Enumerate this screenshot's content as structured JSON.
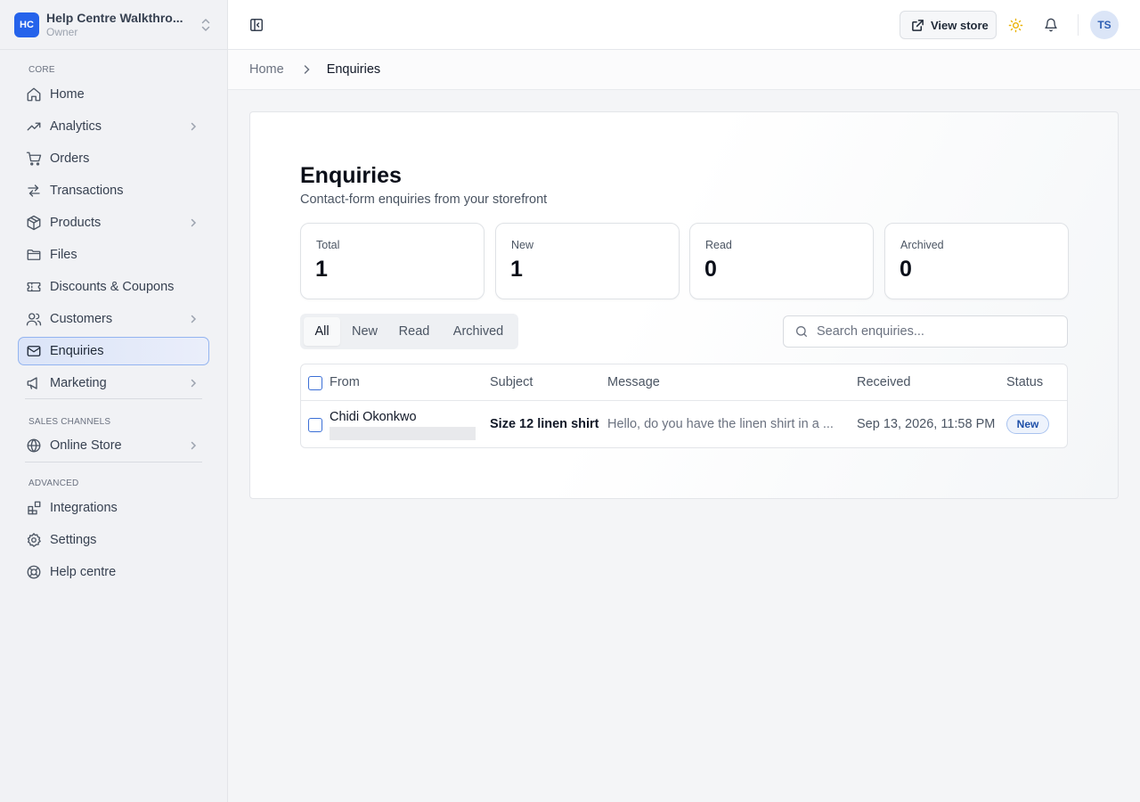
{
  "store": {
    "initials": "HC",
    "name": "Help Centre Walkthro...",
    "role": "Owner"
  },
  "sidebar": {
    "sections": [
      {
        "title": "CORE",
        "items": [
          {
            "label": "Home",
            "icon": "home-icon"
          },
          {
            "label": "Analytics",
            "icon": "trending-up-icon",
            "has_children": true
          },
          {
            "label": "Orders",
            "icon": "cart-icon"
          },
          {
            "label": "Transactions",
            "icon": "arrows-swap-icon"
          },
          {
            "label": "Products",
            "icon": "box-icon",
            "has_children": true
          },
          {
            "label": "Files",
            "icon": "folder-icon"
          },
          {
            "label": "Discounts & Coupons",
            "icon": "ticket-icon"
          },
          {
            "label": "Customers",
            "icon": "users-icon",
            "has_children": true
          },
          {
            "label": "Enquiries",
            "icon": "mail-icon",
            "active": true
          },
          {
            "label": "Marketing",
            "icon": "megaphone-icon",
            "has_children": true
          }
        ]
      },
      {
        "title": "SALES CHANNELS",
        "items": [
          {
            "label": "Online Store",
            "icon": "globe-icon",
            "has_children": true
          }
        ]
      },
      {
        "title": "ADVANCED",
        "items": [
          {
            "label": "Integrations",
            "icon": "blocks-icon"
          },
          {
            "label": "Settings",
            "icon": "gear-icon"
          },
          {
            "label": "Help centre",
            "icon": "lifebuoy-icon"
          }
        ]
      }
    ]
  },
  "topbar": {
    "view_store_label": "View store",
    "avatar_initials": "TS"
  },
  "breadcrumb": {
    "home": "Home",
    "current": "Enquiries"
  },
  "page": {
    "title": "Enquiries",
    "subtitle": "Contact-form enquiries from your storefront"
  },
  "stats": [
    {
      "label": "Total",
      "value": "1"
    },
    {
      "label": "New",
      "value": "1"
    },
    {
      "label": "Read",
      "value": "0"
    },
    {
      "label": "Archived",
      "value": "0"
    }
  ],
  "tabs": [
    {
      "label": "All",
      "active": true
    },
    {
      "label": "New"
    },
    {
      "label": "Read"
    },
    {
      "label": "Archived"
    }
  ],
  "search": {
    "placeholder": "Search enquiries...",
    "value": ""
  },
  "table": {
    "columns": [
      "From",
      "Subject",
      "Message",
      "Received",
      "Status"
    ],
    "rows": [
      {
        "from": "Chidi Okonkwo",
        "subject": "Size 12 linen shirt",
        "message": "Hello, do you have the linen shirt in a ...",
        "received": "Sep 13, 2026, 11:58 PM",
        "status": "New"
      }
    ]
  },
  "colors": {
    "accent": "#2563eb",
    "active_nav_bg": "#dbe4f8",
    "badge_text": "#1e4fa8"
  }
}
